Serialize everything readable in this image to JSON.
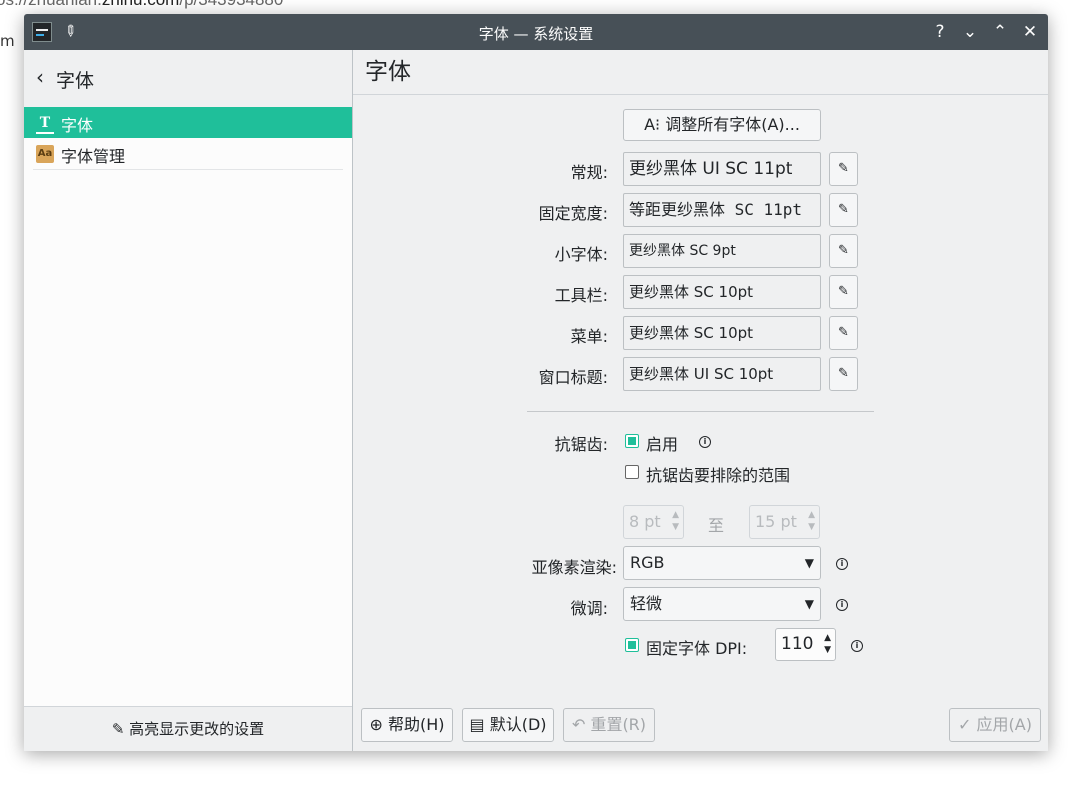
{
  "background": {
    "url_prefix": "os://zhuanlan.",
    "url_domain": "zhihu.com",
    "url_path": "/p/343934880",
    "left_fragment": "m"
  },
  "window": {
    "title": "字体 — 系统设置",
    "buttons": {
      "help": "?",
      "minimize": "⌄",
      "maximize": "⌃",
      "close": "✕"
    }
  },
  "sidebar": {
    "back_icon": "‹",
    "header": "字体",
    "items": [
      {
        "label": "字体",
        "icon": "font-icon",
        "active": true
      },
      {
        "label": "字体管理",
        "icon": "font-management-icon",
        "active": false
      }
    ],
    "footer_label": "高亮显示更改的设置"
  },
  "main": {
    "title": "字体",
    "adjust_all_button": "A⁝ 调整所有字体(A)...",
    "fonts": [
      {
        "label": "常规:",
        "value": "更纱黑体 UI SC 11pt"
      },
      {
        "label": "固定宽度:",
        "value": "等距更纱黑体 SC 11pt"
      },
      {
        "label": "小字体:",
        "value": "更纱黑体 SC 9pt"
      },
      {
        "label": "工具栏:",
        "value": "更纱黑体 SC 10pt"
      },
      {
        "label": "菜单:",
        "value": "更纱黑体 SC 10pt"
      },
      {
        "label": "窗口标题:",
        "value": "更纱黑体 UI SC 10pt"
      }
    ],
    "antialias": {
      "label": "抗锯齿:",
      "enable_label": "启用",
      "enabled": true,
      "exclude_label": "抗锯齿要排除的范围",
      "exclude_enabled": false,
      "range_from": "8 pt",
      "range_to_label": "至",
      "range_to": "15 pt"
    },
    "subpixel": {
      "label": "亚像素渲染:",
      "value": "RGB"
    },
    "hinting": {
      "label": "微调:",
      "value": "轻微"
    },
    "dpi": {
      "label": "固定字体 DPI:",
      "enabled": true,
      "value": "110"
    }
  },
  "footer": {
    "help": "帮助(H)",
    "defaults": "默认(D)",
    "reset": "重置(R)",
    "apply": "应用(A)"
  },
  "colors": {
    "accent": "#1fbf9a",
    "titlebar": "#475057"
  }
}
